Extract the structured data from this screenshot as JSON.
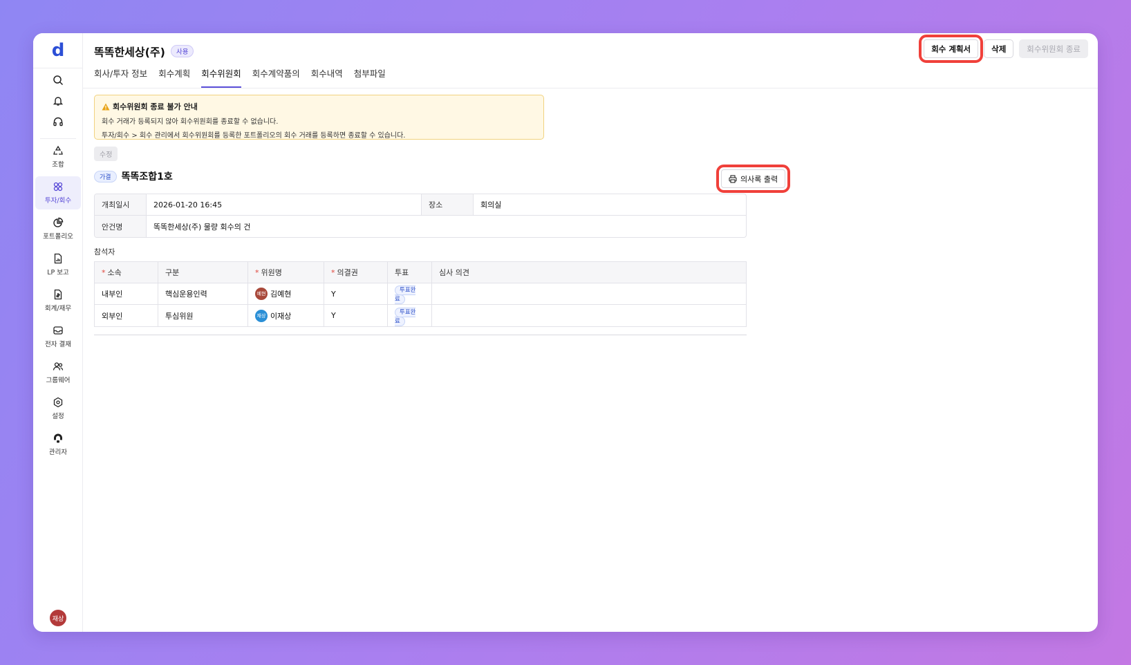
{
  "sidebar": {
    "logo": "d",
    "top_icons": [
      "search-icon",
      "bell-icon",
      "headset-icon"
    ],
    "items": [
      {
        "label": "조합",
        "icon": "recycle-icon",
        "active": false
      },
      {
        "label": "투자/회수",
        "icon": "investment-icon",
        "active": true
      },
      {
        "label": "포트폴리오",
        "icon": "pie-chart-icon",
        "active": false
      },
      {
        "label": "LP 보고",
        "icon": "report-icon",
        "active": false
      },
      {
        "label": "회계/재무",
        "icon": "finance-doc-icon",
        "active": false
      },
      {
        "label": "전자 결재",
        "icon": "inbox-icon",
        "active": false
      },
      {
        "label": "그룹웨어",
        "icon": "people-icon",
        "active": false
      },
      {
        "label": "설정",
        "icon": "gear-icon",
        "active": false
      },
      {
        "label": "관리자",
        "icon": "admin-icon",
        "active": false
      }
    ],
    "user_avatar": "재상"
  },
  "header": {
    "title": "똑똑한세상(주)",
    "status_badge": "사용",
    "tabs": [
      {
        "label": "회사/투자 정보",
        "active": false
      },
      {
        "label": "회수계획",
        "active": false
      },
      {
        "label": "회수위원회",
        "active": true
      },
      {
        "label": "회수계약품의",
        "active": false
      },
      {
        "label": "회수내역",
        "active": false
      },
      {
        "label": "첨부파일",
        "active": false
      }
    ],
    "actions": {
      "plan_label": "회수 계획서",
      "delete_label": "삭제",
      "close_committee_label": "회수위원회 종료"
    }
  },
  "notice": {
    "title": "회수위원회 종료 불가 안내",
    "line1": "회수 거래가 등록되지 않아 회수위원회를 종료할 수 없습니다.",
    "line2": "투자/회수 > 회수 관리에서 회수위원회를 등록한 포트폴리오의 회수 거래를 등록하면 종료할 수 있습니다."
  },
  "edit_label": "수정",
  "committee": {
    "status_tag": "가결",
    "name": "똑똑조합1호",
    "print_minutes_label": "의사록 출력",
    "info": {
      "date_label": "개최일시",
      "date_value": "2026-01-20 16:45",
      "place_label": "장소",
      "place_value": "회의실",
      "agenda_label": "안건명",
      "agenda_value": "똑똑한세상(주) 물량 회수의 건"
    }
  },
  "attendees": {
    "section_label": "참석자",
    "columns": {
      "affiliation": "소속",
      "category": "구분",
      "member": "위원명",
      "voting_right": "의결권",
      "vote": "투표",
      "opinion": "심사 의견"
    },
    "rows": [
      {
        "affiliation": "내부인",
        "category": "핵심운용인력",
        "avatar": "예현",
        "avatar_color": "#a8483a",
        "member": "김예현",
        "voting_right": "Y",
        "vote": "투표완료",
        "opinion": ""
      },
      {
        "affiliation": "외부인",
        "category": "투심위원",
        "avatar": "재상",
        "avatar_color": "#2a8fd6",
        "member": "이재상",
        "voting_right": "Y",
        "vote": "투표완료",
        "opinion": ""
      }
    ]
  },
  "colors": {
    "accent": "#5b4fd9",
    "highlight": "#f0403a",
    "notice_bg": "#fff8e4"
  }
}
